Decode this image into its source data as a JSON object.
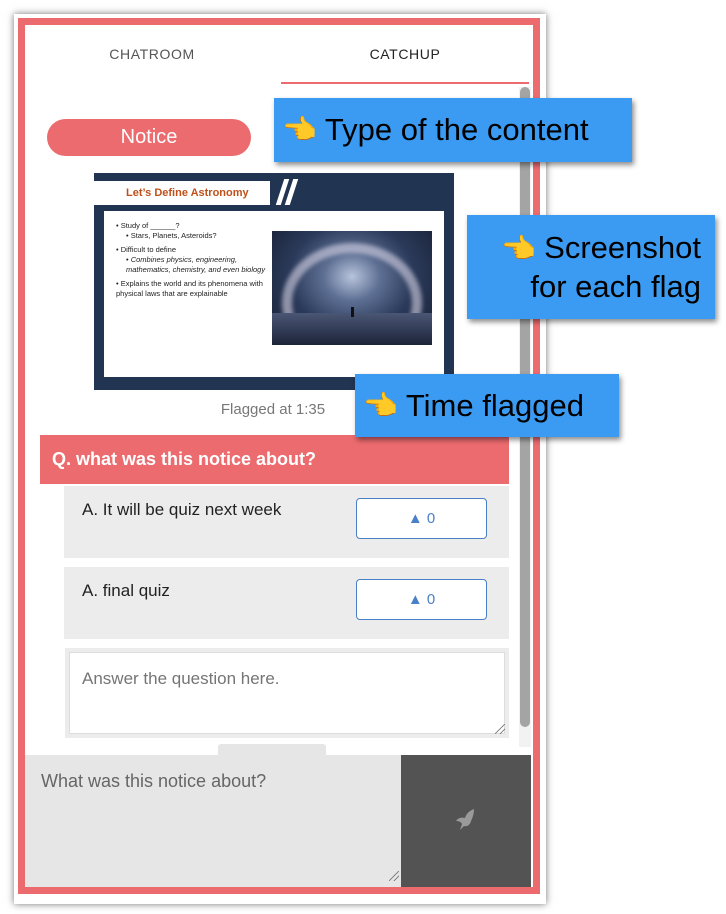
{
  "tabs": [
    {
      "label": "CHATROOM",
      "active": false
    },
    {
      "label": "CATCHUP",
      "active": true
    }
  ],
  "notice": {
    "type_label": "Notice",
    "flag_time": "Flagged at 1:35"
  },
  "slide": {
    "title": "Let’s Define Astronomy",
    "bullets": [
      {
        "text": "Study of ______?",
        "sub": [
          "Stars, Planets, Asteroids?"
        ]
      },
      {
        "text": "Difficult to define",
        "sub": [
          "Combines physics, engineering, mathematics, chemistry, and even biology"
        ]
      },
      {
        "text": "Explains the world and its phenomena with physical laws that are explainable",
        "sub": []
      }
    ]
  },
  "question": {
    "text": "Q. what was this notice about?",
    "answers": [
      {
        "text": "A. It will be quiz next week",
        "votes": "▲ 0"
      },
      {
        "text": "A. final quiz",
        "votes": "▲ 0"
      }
    ],
    "answer_placeholder": "Answer the question here."
  },
  "composer": {
    "value": "What was this notice about?"
  },
  "callouts": {
    "hand": "👈",
    "type": "Type of the content",
    "screenshot_line1": "Screenshot",
    "screenshot_line2": "for each flag",
    "time": "Time flagged"
  },
  "colors": {
    "accent": "#ec6b6f",
    "vote": "#4a80c8",
    "callout": "#3b9bf2",
    "send_button": "#535353"
  },
  "icons": {
    "send": "send-bird-icon",
    "hand": "hand-pointing-icon"
  }
}
